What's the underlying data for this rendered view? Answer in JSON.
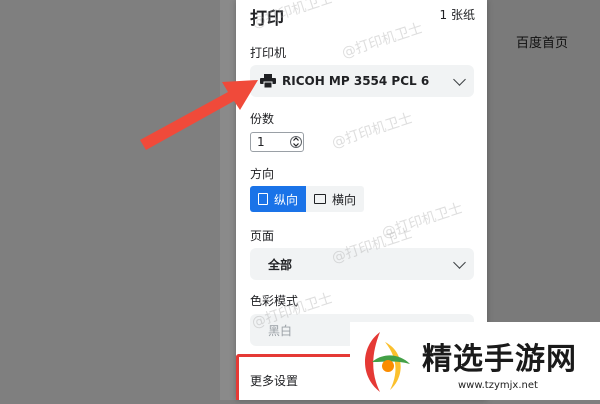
{
  "background": {
    "right_link": "百度首页"
  },
  "dialog": {
    "title": "打印",
    "sheet_count": "1 张纸",
    "printer": {
      "label": "打印机",
      "value": "RICOH MP 3554 PCL 6"
    },
    "copies": {
      "label": "份数",
      "value": "1"
    },
    "orientation": {
      "label": "方向",
      "portrait": "纵向",
      "landscape": "横向",
      "selected": "portrait"
    },
    "pages": {
      "label": "页面",
      "value": "全部"
    },
    "color_mode": {
      "label": "色彩模式",
      "value": "黑白"
    },
    "more_settings": "更多设置"
  },
  "watermarks": [
    "@打印机卫士",
    "@打印机卫士",
    "@打印机卫士",
    "@打印机卫士",
    "@打印机卫士",
    "@打印机卫士"
  ],
  "branding": {
    "name": "精选手游网",
    "url": "www.tzymjx.net"
  },
  "colors": {
    "accent": "#1a73e8",
    "highlight": "#e53935",
    "panel_bg": "#ffffff",
    "overlay": "#7f7f7f"
  }
}
